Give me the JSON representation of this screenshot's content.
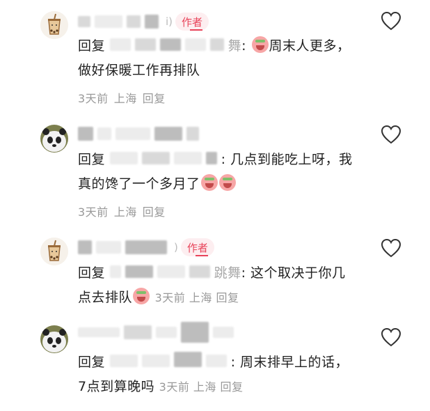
{
  "comments": [
    {
      "badge": "作者",
      "reply_prefix": "回复",
      "reply_target_visible": "舞",
      "text": "周末人更多，做好保暖工作再排队",
      "meta": {
        "time": "3天前",
        "location": "上海",
        "reply": "回复"
      }
    },
    {
      "badge": "",
      "reply_prefix": "回复",
      "reply_target_visible": "",
      "text": "几点到能吃上呀，我真的馋了一个多月了",
      "meta": {
        "time": "3天前",
        "location": "上海",
        "reply": "回复"
      }
    },
    {
      "badge": "作者",
      "reply_prefix": "回复",
      "reply_target_visible": "跳舞",
      "text": "这个取决于你几点去排队",
      "meta": {
        "time": "3天前",
        "location": "上海",
        "reply": "回复"
      }
    },
    {
      "badge": "",
      "reply_prefix": "回复",
      "reply_target_visible": "",
      "text": "周末排早上的话，7点到算晚吗",
      "meta": {
        "time": "3天前",
        "location": "上海",
        "reply": "回复"
      }
    }
  ],
  "icons": {
    "avatar_author": "bubble-tea-icon",
    "avatar_user": "panda-avatar",
    "like": "heart-outline-icon",
    "emoji": "crying-face-emoji"
  },
  "colors": {
    "badge_text": "#e8445a",
    "badge_bg": "#fdeef0",
    "meta": "#999999"
  }
}
